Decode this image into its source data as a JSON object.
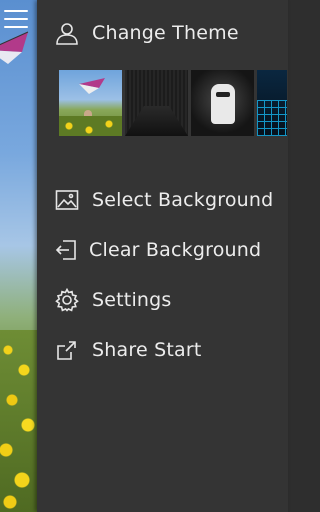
{
  "menu": {
    "change_theme": "Change Theme",
    "select_background": "Select Background",
    "clear_background": "Clear Background",
    "settings": "Settings",
    "share_start": "Share Start"
  },
  "theme_thumbnails": [
    "kite-field",
    "dark-texture",
    "stormtrooper",
    "blue-grid"
  ],
  "icons": {
    "menu": "hamburger-icon",
    "theme": "user-icon",
    "background": "image-icon",
    "clear": "sign-out-icon",
    "settings": "gear-icon",
    "share": "share-icon"
  },
  "colors": {
    "drawer": "#343434",
    "text": "#ececec"
  }
}
